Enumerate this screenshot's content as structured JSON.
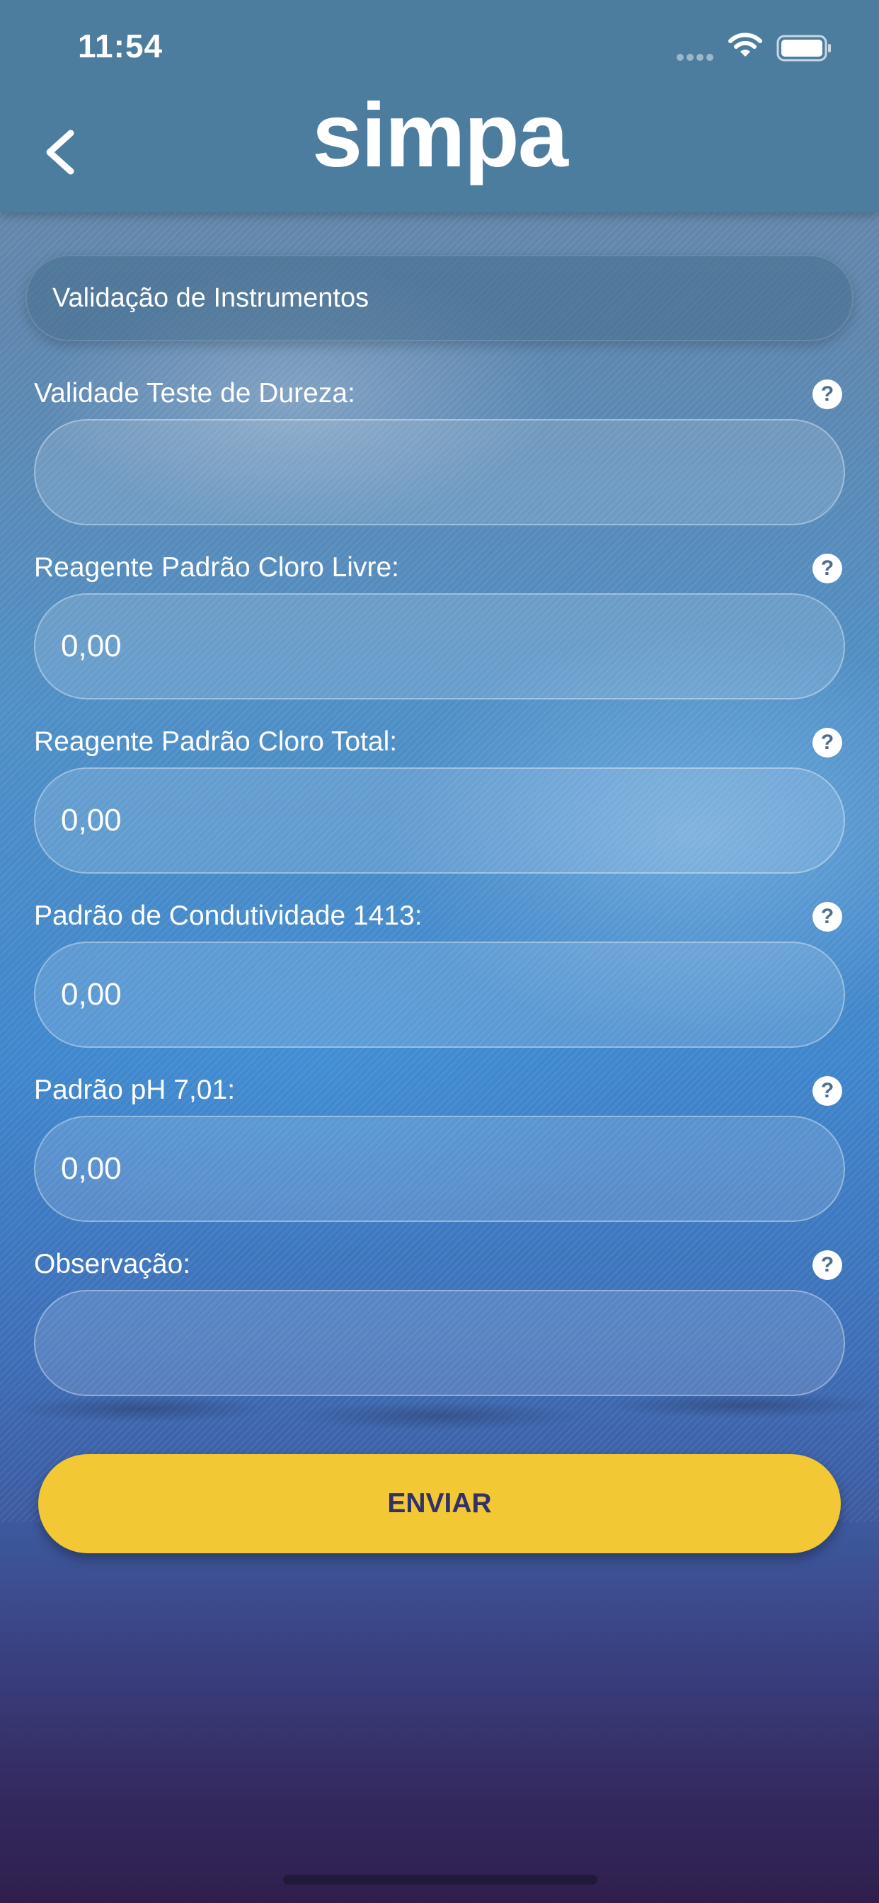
{
  "status_bar": {
    "time": "11:54"
  },
  "header": {
    "logo": "simpa",
    "back_icon": "chevron-left-icon"
  },
  "section": {
    "title": "Validação de Instrumentos"
  },
  "fields": [
    {
      "label": "Validade Teste de Dureza:",
      "value": ""
    },
    {
      "label": "Reagente Padrão Cloro Livre:",
      "value": "0,00"
    },
    {
      "label": "Reagente Padrão Cloro Total:",
      "value": "0,00"
    },
    {
      "label": "Padrão de Condutividade 1413:",
      "value": "0,00"
    },
    {
      "label": "Padrão pH 7,01:",
      "value": "0,00"
    },
    {
      "label": "Observação:",
      "value": ""
    }
  ],
  "help_icon_symbol": "?",
  "submit": {
    "label": "ENVIAR"
  },
  "colors": {
    "header": "#4c7d9f",
    "button": "#f2c935",
    "button_text": "#33306a"
  }
}
